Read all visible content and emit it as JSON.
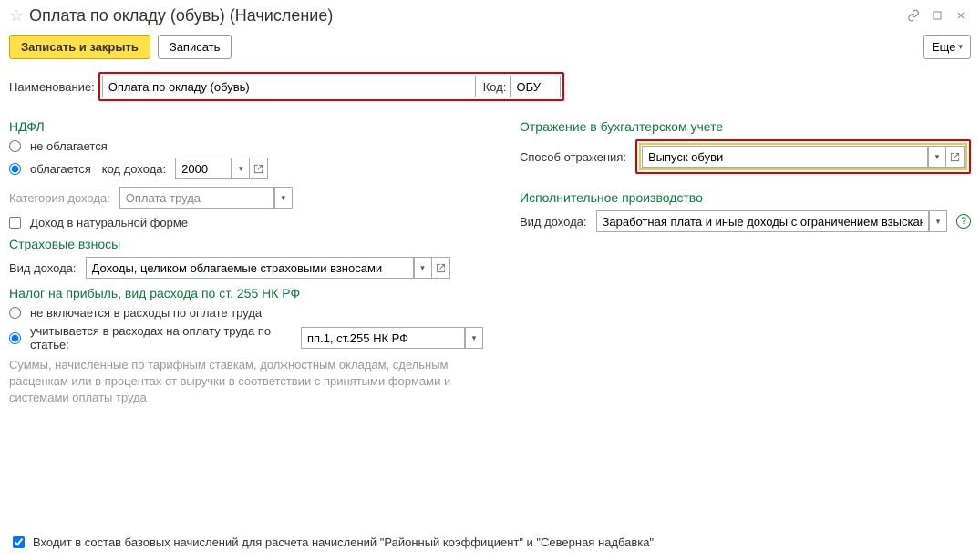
{
  "header": {
    "title": "Оплата по окладу (обувь) (Начисление)"
  },
  "toolbar": {
    "save_close": "Записать и закрыть",
    "save": "Записать",
    "more": "Еще"
  },
  "main": {
    "name_label": "Наименование:",
    "name_value": "Оплата по окладу (обувь)",
    "code_label": "Код:",
    "code_value": "ОБУ"
  },
  "ndfl": {
    "title": "НДФЛ",
    "not_taxed": "не облагается",
    "taxed": "облагается",
    "income_code_label": "код дохода:",
    "income_code_value": "2000",
    "category_label": "Категория дохода:",
    "category_value": "Оплата труда",
    "natural_form": "Доход в натуральной форме"
  },
  "insurance": {
    "title": "Страховые взносы",
    "income_type_label": "Вид дохода:",
    "income_type_value": "Доходы, целиком облагаемые страховыми взносами"
  },
  "profit_tax": {
    "title": "Налог на прибыль, вид расхода по ст. 255 НК РФ",
    "not_included": "не включается в расходы по оплате труда",
    "included": "учитывается в расходах на оплату труда по статье:",
    "article_value": "пп.1, ст.255 НК РФ",
    "hint": "Суммы, начисленные по тарифным ставкам, должностным окладам, сдельным расценкам или в процентах от выручки в соответствии с принятыми формами и системами оплаты труда"
  },
  "accounting": {
    "title": "Отражение в бухгалтерском учете",
    "method_label": "Способ отражения:",
    "method_value": "Выпуск обуви"
  },
  "enforcement": {
    "title": "Исполнительное производство",
    "income_type_label": "Вид дохода:",
    "income_type_value": "Заработная плата и иные доходы с ограничением взыскан"
  },
  "footer": {
    "base_check": "Входит в состав базовых начислений для расчета начислений \"Районный коэффициент\" и \"Северная надбавка\""
  }
}
